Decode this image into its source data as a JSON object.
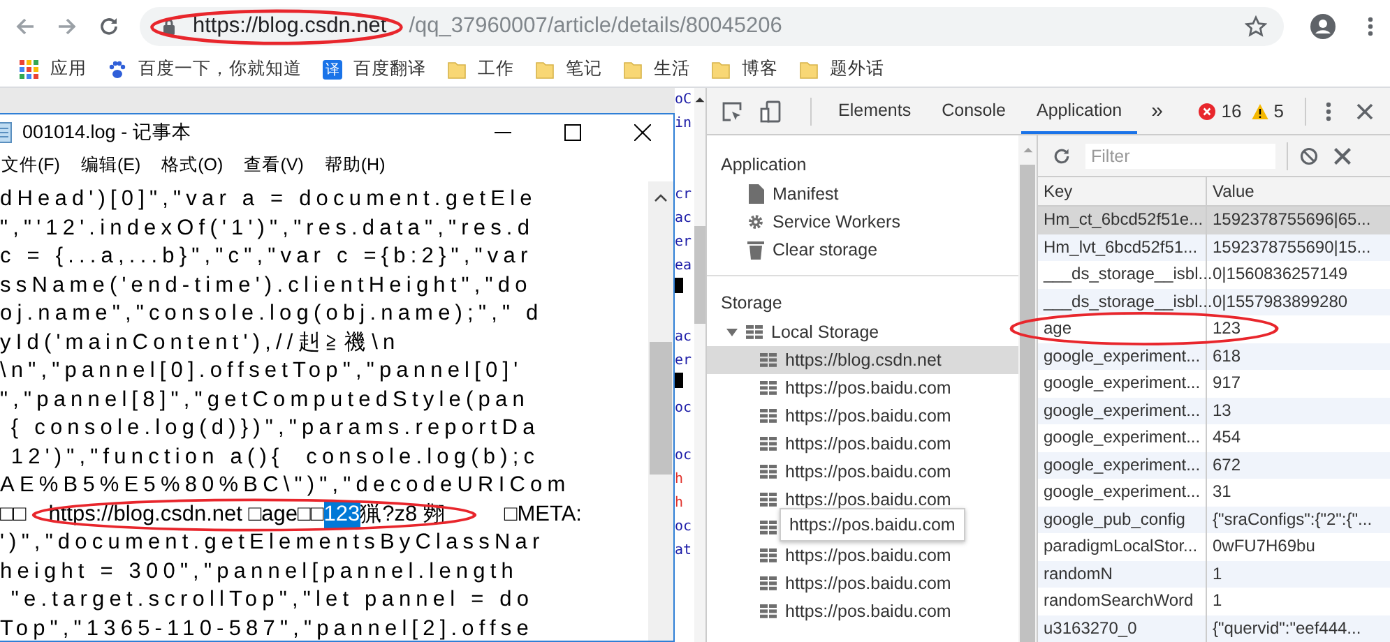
{
  "browser": {
    "url": {
      "host": "https://blog.csdn.net",
      "path": "/qq_37960007/article/details/80045206",
      "circled": true
    }
  },
  "bookmarks": [
    {
      "label": "应用",
      "kind": "apps"
    },
    {
      "label": "百度一下，你就知道",
      "kind": "paw"
    },
    {
      "label": "百度翻译",
      "kind": "translate",
      "badge": "译"
    },
    {
      "label": "工作",
      "kind": "folder"
    },
    {
      "label": "笔记",
      "kind": "folder"
    },
    {
      "label": "生活",
      "kind": "folder"
    },
    {
      "label": "博客",
      "kind": "folder"
    },
    {
      "label": "题外话",
      "kind": "folder"
    }
  ],
  "notepad": {
    "title": "001014.log - 记事本",
    "menu": [
      "文件(F)",
      "编辑(E)",
      "格式(O)",
      "查看(V)",
      "帮助(H)"
    ],
    "lines": [
      {
        "text": "dHead')[0]\",\"var a = document.getEle"
      },
      {
        "text": "\",\"'12'.indexOf('1')\",\"res.data\",\"res.d"
      },
      {
        "text": "c = {...a,...b}\",\"c\",\"var c ={b:2}\",\"var"
      },
      {
        "text": "ssName('end-time').clientHeight\",\"do"
      },
      {
        "text": "oj.name\",\"console.log(obj.name);\",\" d"
      },
      {
        "text": "yId('mainContent'),//赳≧禨\\n"
      },
      {
        "text": "\\n\",\"pannel[0].offsetTop\",\"pannel[0]'"
      },
      {
        "text": "\",\"pannel[8]\",\"getComputedStyle(pan"
      },
      {
        "text": " { console.log(d)})\",\"params.reportDa"
      },
      {
        "text": " 12')\",\"function a(){  console.log(b);c"
      },
      {
        "text": "AE%B5%E5%80%BC\\\")\",\"decodeURICom"
      },
      {
        "kind": "selection",
        "lead": "□□",
        "before": "https://blog.csdn.net □age□□",
        "selected": "123",
        "after": "猟?z8 翙",
        "tail": "□META:",
        "circled": true
      },
      {
        "text": "')\",\"document.getElementsByClassNar"
      },
      {
        "text": "height = 300\",\"pannel[pannel.length"
      },
      {
        "text": " \"e.target.scrollTop\",\"let pannel = do"
      },
      {
        "text": "Top\",\"1365-110-587\",\"pannel[2].offse"
      }
    ]
  },
  "background_editor": [
    {
      "text": "oC",
      "color": "#1a1aa6"
    },
    {
      "text": "in",
      "color": "#1a1aa6"
    },
    {
      "kind": "blank"
    },
    {
      "kind": "blank"
    },
    {
      "text": "cr",
      "color": "#1a1aa6"
    },
    {
      "text": "ac",
      "color": "#1a1aa6"
    },
    {
      "text": "er",
      "color": "#1a1aa6"
    },
    {
      "text": "ea",
      "color": "#1a1aa6"
    },
    {
      "kind": "cursor"
    },
    {
      "kind": "blank"
    },
    {
      "text": "ac",
      "color": "#1a1aa6"
    },
    {
      "text": "er",
      "color": "#1a1aa6"
    },
    {
      "kind": "cursor"
    },
    {
      "text": "oc",
      "color": "#1a1aa6"
    },
    {
      "kind": "blank"
    },
    {
      "text": "oc",
      "color": "#1a1aa6"
    },
    {
      "text": "h",
      "color": "#e0312b"
    },
    {
      "text": "h",
      "color": "#e0312b"
    },
    {
      "text": "oc",
      "color": "#1a1aa6"
    },
    {
      "text": "at",
      "color": "#1a1aa6"
    }
  ],
  "devtools": {
    "tabs": [
      {
        "label": "Elements",
        "selected": false
      },
      {
        "label": "Console",
        "selected": false
      },
      {
        "label": "Application",
        "selected": true
      }
    ],
    "more": "»",
    "errors": "16",
    "warnings": "5",
    "sidebar": {
      "application": {
        "title": "Application",
        "items": [
          {
            "label": "Manifest",
            "kind": "file"
          },
          {
            "label": "Service Workers",
            "kind": "gear"
          },
          {
            "label": "Clear storage",
            "kind": "trash"
          }
        ]
      },
      "storage": {
        "title": "Storage",
        "tree": {
          "label": "Local Storage",
          "expanded": true,
          "children": [
            {
              "label": "https://blog.csdn.net",
              "selected": true
            },
            {
              "label": "https://pos.baidu.com",
              "selected": false
            },
            {
              "label": "https://pos.baidu.com",
              "selected": false
            },
            {
              "label": "https://pos.baidu.com",
              "selected": false
            },
            {
              "label": "https://pos.baidu.com",
              "selected": false
            },
            {
              "label": "https://pos.baidu.com",
              "selected": false
            },
            {
              "tooltip": "https://pos.baidu.com",
              "selected": false
            },
            {
              "label": "https://pos.baidu.com",
              "selected": false
            },
            {
              "label": "https://pos.baidu.com",
              "selected": false
            },
            {
              "label": "https://pos.baidu.com",
              "selected": false
            }
          ]
        }
      }
    },
    "filter": {
      "placeholder": "Filter"
    },
    "table": {
      "columns": [
        "Key",
        "Value"
      ],
      "rows": [
        {
          "key": "Hm_ct_6bcd52f51e...",
          "value": "1592378755696|65...",
          "selected": true
        },
        {
          "key": "Hm_lvt_6bcd52f51...",
          "value": "1592378755690|15...",
          "selected": false
        },
        {
          "key": "___ds_storage__isbl...",
          "value": "0|1560836257149",
          "selected": false
        },
        {
          "key": "___ds_storage__isbl...",
          "value": "0|1557983899280",
          "selected": false
        },
        {
          "key": "age",
          "value": "123",
          "selected": false,
          "circled": true
        },
        {
          "key": "google_experiment...",
          "value": "618",
          "selected": false
        },
        {
          "key": "google_experiment...",
          "value": "917",
          "selected": false
        },
        {
          "key": "google_experiment...",
          "value": "13",
          "selected": false
        },
        {
          "key": "google_experiment...",
          "value": "454",
          "selected": false
        },
        {
          "key": "google_experiment...",
          "value": "672",
          "selected": false
        },
        {
          "key": "google_experiment...",
          "value": "31",
          "selected": false
        },
        {
          "key": "google_pub_config",
          "value": "{\"sraConfigs\":{\"2\":{\"...",
          "selected": false
        },
        {
          "key": "paradigmLocalStor...",
          "value": "0wFU7H69bu",
          "selected": false
        },
        {
          "key": "randomN",
          "value": "1",
          "selected": false
        },
        {
          "key": "randomSearchWord",
          "value": "1",
          "selected": false
        },
        {
          "key": "u3163270_0",
          "value": "{\"quervid\":\"eef444...",
          "selected": false
        }
      ]
    }
  }
}
